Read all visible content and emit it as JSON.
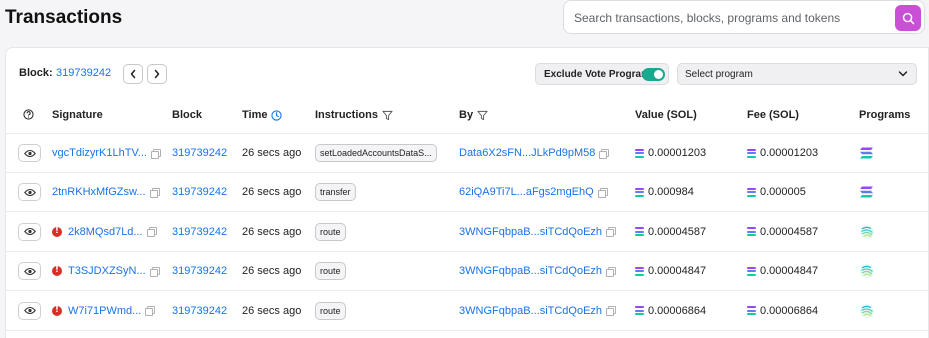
{
  "header": {
    "title": "Transactions",
    "search_placeholder": "Search transactions, blocks, programs and tokens"
  },
  "toolbar": {
    "block_label": "Block:",
    "block_number": "319739242",
    "exclude_vote_label": "Exclude Vote Program",
    "exclude_vote_enabled": true,
    "select_program_label": "Select program"
  },
  "columns": {
    "signature": "Signature",
    "block": "Block",
    "time": "Time",
    "instructions": "Instructions",
    "by": "By",
    "value": "Value (SOL)",
    "fee": "Fee (SOL)",
    "programs": "Programs"
  },
  "rows": [
    {
      "error": false,
      "signature": "vgcTdizyrK1LhTV...",
      "block": "319739242",
      "time": "26 secs ago",
      "instruction": "setLoadedAccountsDataS...",
      "by": "Data6X2sFN...JLkPd9pM58",
      "value": "0.00001203",
      "fee": "0.00001203",
      "program_icon": "solana-icon"
    },
    {
      "error": false,
      "signature": "2tnRKHxMfGZsw...",
      "block": "319739242",
      "time": "26 secs ago",
      "instruction": "transfer",
      "by": "62iQA9Ti7L...aFgs2mgEhQ",
      "value": "0.000984",
      "fee": "0.000005",
      "program_icon": "solana-icon"
    },
    {
      "error": true,
      "signature": "2k8MQsd7Ld...",
      "block": "319739242",
      "time": "26 secs ago",
      "instruction": "route",
      "by": "3WNGFqbpaB...siTCdQoEzh",
      "value": "0.00004587",
      "fee": "0.00004587",
      "program_icon": "jupiter-icon"
    },
    {
      "error": true,
      "signature": "T3SJDXZSyN...",
      "block": "319739242",
      "time": "26 secs ago",
      "instruction": "route",
      "by": "3WNGFqbpaB...siTCdQoEzh",
      "value": "0.00004847",
      "fee": "0.00004847",
      "program_icon": "jupiter-icon"
    },
    {
      "error": true,
      "signature": "W7i71PWmd...",
      "block": "319739242",
      "time": "26 secs ago",
      "instruction": "route",
      "by": "3WNGFqbpaB...siTCdQoEzh",
      "value": "0.00006864",
      "fee": "0.00006864",
      "program_icon": "jupiter-icon"
    }
  ],
  "colors": {
    "link": "#1a73e8",
    "accent": "#c94fd6",
    "toggle": "#18a98e",
    "error": "#d93025"
  }
}
